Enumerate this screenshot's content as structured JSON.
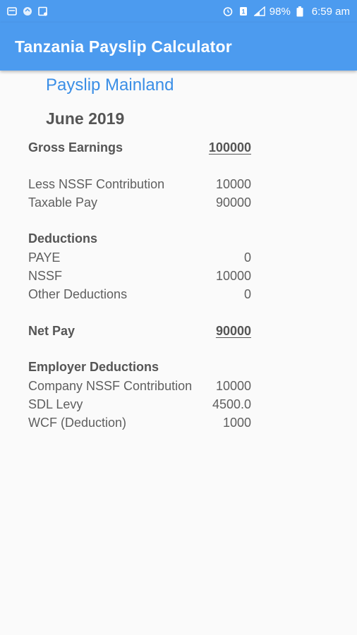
{
  "status_bar": {
    "battery_percent": "98%",
    "time": "6:59 am"
  },
  "app_bar": {
    "title": "Tanzania Payslip Calculator"
  },
  "payslip": {
    "section_title": "Payslip Mainland",
    "period": "June 2019",
    "gross": {
      "label": "Gross Earnings",
      "value": "100000"
    },
    "less_nssf": {
      "label": "Less NSSF Contribution",
      "value": "10000"
    },
    "taxable_pay": {
      "label": "Taxable Pay",
      "value": "90000"
    },
    "deductions_heading": "Deductions",
    "paye": {
      "label": "PAYE",
      "value": "0"
    },
    "nssf": {
      "label": "NSSF",
      "value": "10000"
    },
    "other": {
      "label": "Other Deductions",
      "value": "0"
    },
    "net_pay": {
      "label": "Net Pay",
      "value": "90000"
    },
    "employer_heading": "Employer Deductions",
    "company_nssf": {
      "label": "Company NSSF Contribution",
      "value": "10000"
    },
    "sdl": {
      "label": "SDL Levy",
      "value": "4500.0"
    },
    "wcf": {
      "label": "WCF (Deduction)",
      "value": "1000"
    }
  },
  "colors": {
    "primary": "#4c9bef",
    "accent_text": "#3a8ee6",
    "background": "#fafafa"
  }
}
